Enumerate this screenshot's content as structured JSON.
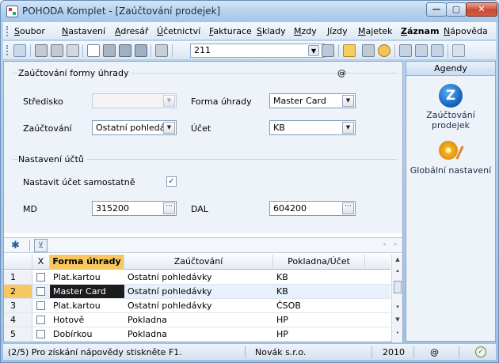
{
  "window": {
    "title": "POHODA Komplet - [Zaúčtování prodejek]",
    "min_label": "—",
    "max_label": "▢",
    "close_label": "✕"
  },
  "menu": {
    "items": [
      "Soubor",
      "Nastavení",
      "Adresář",
      "Účetnictví",
      "Fakturace",
      "Sklady",
      "Mzdy",
      "Jízdy",
      "Majetek",
      "Záznam",
      "Nápověda"
    ]
  },
  "toolbar": {
    "record_combo_value": "211",
    "icons": [
      "filter-icon",
      "print-icon",
      "print-preview-icon",
      "new-record-icon",
      "edit-icon",
      "save-icon",
      "save-copy-icon",
      "copy-icon",
      "folder-icon",
      "calculator-icon",
      "coins-icon",
      "window-icon",
      "window-list-icon",
      "help-icon"
    ]
  },
  "form": {
    "group1_title": "Zaúčtování formy úhrady",
    "at_symbol": "@",
    "stredisko_label": "Středisko",
    "stredisko_value": "",
    "forma_uhrady_label": "Forma úhrady",
    "forma_uhrady_value": "Master Card",
    "zauctovani_label": "Zaúčtování",
    "zauctovani_value": "Ostatní pohledáv",
    "ucet_label": "Účet",
    "ucet_value": "KB",
    "group2_title": "Nastavení účtů",
    "nastavit_label": "Nastavit účet samostatně",
    "nastavit_checked": "✓",
    "md_label": "MD",
    "md_value": "315200",
    "dal_label": "DAL",
    "dal_value": "604200",
    "dots": "···"
  },
  "grid": {
    "new_symbol": "✱",
    "filter_symbol": "⊻",
    "nav_symbols": "◂ ▸",
    "headers": {
      "x": "X",
      "forma_uhrady": "Forma úhrady",
      "zauctovani": "Zaúčtování",
      "pokladna_ucet": "Pokladna/Účet"
    },
    "rows": [
      {
        "num": "1",
        "forma": "Plat.kartou",
        "zauct": "Ostatní pohledávky",
        "ucet": "KB"
      },
      {
        "num": "2",
        "forma": "Master Card",
        "zauct": "Ostatní pohledávky",
        "ucet": "KB"
      },
      {
        "num": "3",
        "forma": "Plat.kartou",
        "zauct": "Ostatní pohledávky",
        "ucet": "ČSOB"
      },
      {
        "num": "4",
        "forma": "Hotově",
        "zauct": "Pokladna",
        "ucet": "HP"
      },
      {
        "num": "5",
        "forma": "Dobírkou",
        "zauct": "Pokladna",
        "ucet": "HP"
      }
    ],
    "active_row_index": 2
  },
  "sidebar": {
    "header": "Agendy",
    "item1_label": "Zaúčtování prodejek",
    "item1_icon": "Z",
    "item2_label": "Globální nastavení"
  },
  "status": {
    "help_text": "(2/5) Pro získání nápovědy stiskněte F1.",
    "company": "Novák s.r.o.",
    "year": "2010",
    "at": "@",
    "ok": "✓"
  },
  "colors": {
    "accent_orange": "#f8c860",
    "window_blue": "#bcd6ef",
    "close_red": "#c74a34"
  }
}
